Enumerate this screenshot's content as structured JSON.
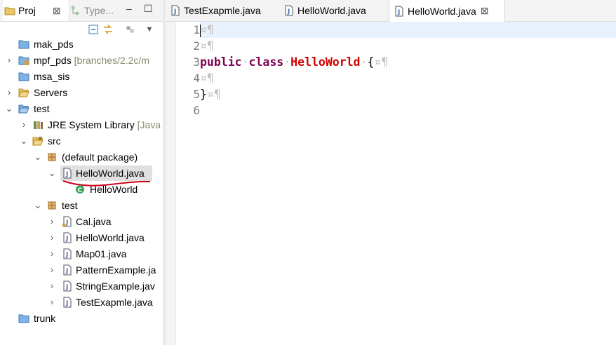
{
  "left_view": {
    "tabs": [
      {
        "label": "Proj",
        "close": "⊠"
      },
      {
        "label": "Type..."
      }
    ],
    "minimize_icon": "–",
    "maximize_icon": "☐",
    "tree": [
      {
        "label": "mak_pds"
      },
      {
        "label": "mpf_pds",
        "decoration": "[branches/2.2c/m"
      },
      {
        "label": "msa_sis"
      },
      {
        "label": "Servers"
      },
      {
        "label": "test"
      },
      {
        "label": "JRE System Library",
        "decoration": "[Java"
      },
      {
        "label": "src"
      },
      {
        "label": "(default package)"
      },
      {
        "label": "HelloWorld.java"
      },
      {
        "label": "HelloWorld"
      },
      {
        "label": "test"
      },
      {
        "label": "Cal.java"
      },
      {
        "label": "HelloWorld.java"
      },
      {
        "label": "Map01.java"
      },
      {
        "label": "PatternExample.ja"
      },
      {
        "label": "StringExample.jav"
      },
      {
        "label": "TestExapmle.java"
      },
      {
        "label": "trunk"
      }
    ]
  },
  "editor": {
    "tabs": [
      {
        "label": "TestExapmle.java"
      },
      {
        "label": "HelloWorld.java"
      },
      {
        "label": "HelloWorld.java",
        "close": "⊠"
      }
    ],
    "line_numbers": [
      "1",
      "2",
      "3",
      "4",
      "5",
      "6"
    ],
    "code": {
      "line3_kw1": "public",
      "line3_kw2": "class",
      "line3_class": "HelloWorld",
      "line3_brace": "{",
      "line5_brace": "}",
      "ws_mark": "¤¶",
      "ws_dot": "·"
    }
  },
  "colors": {
    "keyword": "#7f0055",
    "class_name": "#d10000",
    "underline_annotation": "#d0021b",
    "current_line": "#e8f2fe"
  }
}
